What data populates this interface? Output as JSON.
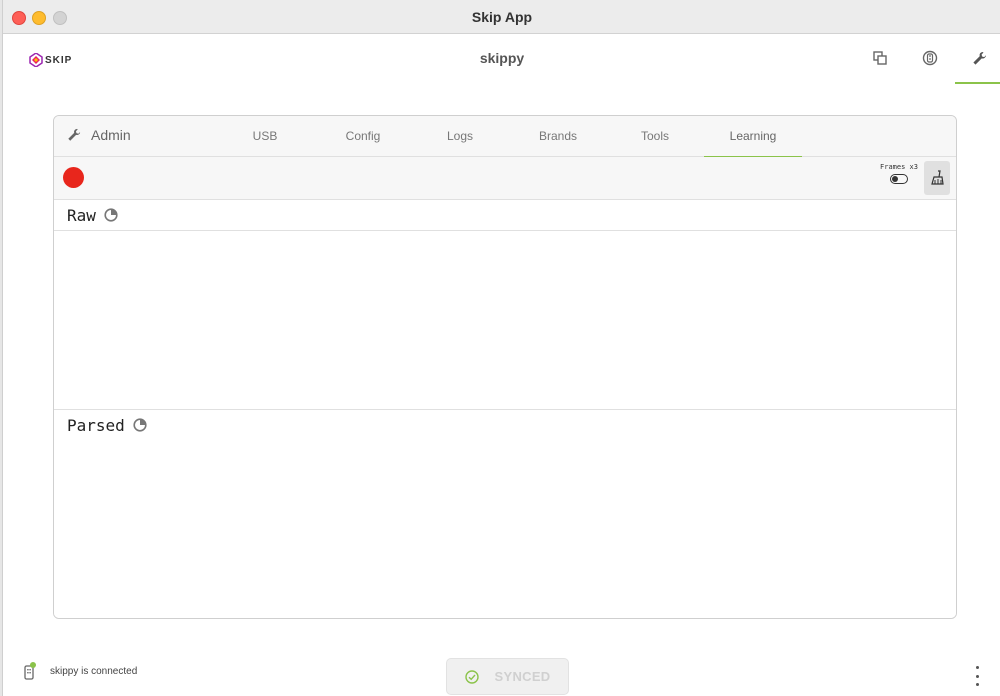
{
  "window": {
    "title": "Skip App"
  },
  "appbar": {
    "logo_text": "SKIP",
    "device_title": "skippy",
    "buttons": [
      {
        "name": "copy-icon"
      },
      {
        "name": "remote-icon"
      },
      {
        "name": "wrench-icon",
        "active": true
      }
    ]
  },
  "tabs": {
    "admin_label": "Admin",
    "items": [
      {
        "label": "USB"
      },
      {
        "label": "Config"
      },
      {
        "label": "Logs"
      },
      {
        "label": "Brands"
      },
      {
        "label": "Tools"
      },
      {
        "label": "Learning",
        "active": true
      }
    ]
  },
  "toolbar": {
    "frames_label": "Frames x3",
    "frames_toggle_on": false
  },
  "sections": {
    "raw_title": "Raw",
    "parsed_title": "Parsed"
  },
  "status": {
    "connection_text": "skippy is connected",
    "synced_label": "SYNCED"
  },
  "colors": {
    "accent": "#8bc34a",
    "record": "#e8261c"
  }
}
